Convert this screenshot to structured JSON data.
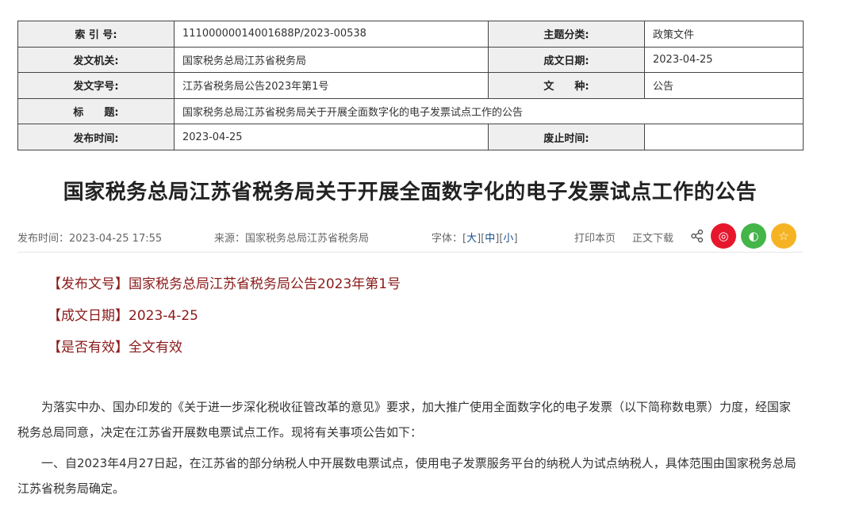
{
  "meta": {
    "index_label": "索 引 号:",
    "index_value": "11100000014001688P/2023-00538",
    "topic_label": "主题分类:",
    "topic_value": "政策文件",
    "issuer_label": "发文机关:",
    "issuer_value": "国家税务总局江苏省税务局",
    "date_label": "成文日期:",
    "date_value": "2023-04-25",
    "docno_label": "发文字号:",
    "docno_value": "江苏省税务局公告2023年第1号",
    "type_label": "文　　种:",
    "type_value": "公告",
    "title_label": "标　　题:",
    "title_value": "国家税务总局江苏省税务局关于开展全面数字化的电子发票试点工作的公告",
    "publish_label": "发布时间:",
    "publish_value": "2023-04-25",
    "expire_label": "废止时间:",
    "expire_value": ""
  },
  "article": {
    "title": "国家税务总局江苏省税务局关于开展全面数字化的电子发票试点工作的公告",
    "publish_time": "发布时间：2023-04-25 17:55",
    "source": "来源：国家税务总局江苏省税务局",
    "font_prefix": "字体：[",
    "font_large": "大",
    "font_sep1": "][",
    "font_medium": "中",
    "font_sep2": "][",
    "font_small": "小",
    "font_suffix": "]",
    "print": "打印本页",
    "download": "正文下载"
  },
  "social": {
    "weibo_color": "#e6162d",
    "wechat_color": "#44b549",
    "favorite_color": "#f5b324",
    "weibo_glyph": "◎",
    "wechat_glyph": "◐",
    "favorite_glyph": "☆"
  },
  "attrs": {
    "docno": "【发布文号】国家税务总局江苏省税务局公告2023年第1号",
    "date": "【成文日期】2023-4-25",
    "valid": "【是否有效】全文有效"
  },
  "body": {
    "p1": "为落实中办、国办印发的《关于进一步深化税收征管改革的意见》要求，加大推广使用全面数字化的电子发票（以下简称数电票）力度，经国家税务总局同意，决定在江苏省开展数电票试点工作。现将有关事项公告如下：",
    "p2": "一、自2023年4月27日起，在江苏省的部分纳税人中开展数电票试点，使用电子发票服务平台的纳税人为试点纳税人，具体范围由国家税务总局江苏省税务局确定。"
  }
}
